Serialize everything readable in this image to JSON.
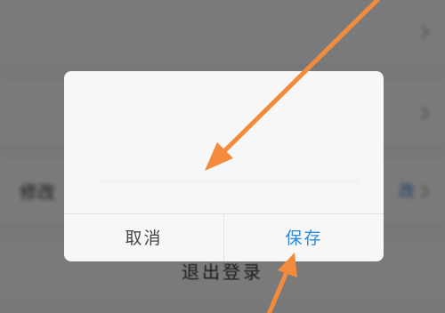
{
  "background": {
    "rows": [
      {
        "label": "",
        "value": "",
        "link": ""
      },
      {
        "label": "",
        "value": "",
        "link": ""
      },
      {
        "label": "修改",
        "value": "",
        "link": "改"
      }
    ],
    "logout_label": "退出登录"
  },
  "dialog": {
    "title": "",
    "input_value": "",
    "cancel_label": "取消",
    "save_label": "保存"
  },
  "colors": {
    "overlay": "#000000",
    "save_text": "#2d88dc",
    "arrow": "#f28c3c"
  },
  "icons": {
    "row_chevron": "chevron-right-icon",
    "annotation_arrow": "arrow-annotation-icon"
  }
}
